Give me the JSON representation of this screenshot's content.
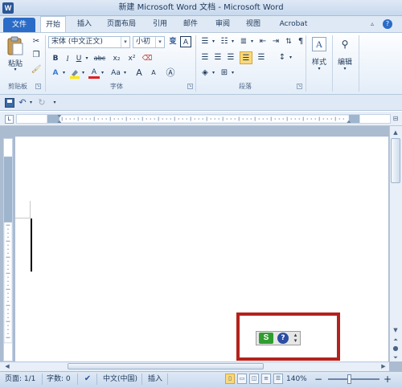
{
  "window": {
    "title": "新建 Microsoft Word 文档 - Microsoft Word",
    "app_icon": "W"
  },
  "tabs": {
    "file": "文件",
    "home": "开始",
    "insert": "插入",
    "page_layout": "页面布局",
    "references": "引用",
    "mailings": "邮件",
    "review": "审阅",
    "view": "视图",
    "acrobat": "Acrobat"
  },
  "ribbon": {
    "clipboard": {
      "label": "剪贴板",
      "paste_label": "粘贴"
    },
    "font": {
      "label": "字体",
      "font_name": "宋体 (中文正文)",
      "font_size": "小初",
      "bold": "B",
      "italic": "I",
      "underline": "U",
      "strike": "abc",
      "subscript": "x₂",
      "superscript": "x²",
      "wen": "A",
      "font_color": "A",
      "grow": "A",
      "shrink": "A",
      "change_case": "Aa",
      "phonetic": "变",
      "char_border": "A"
    },
    "paragraph": {
      "label": "段落"
    },
    "styles": {
      "label": "样式"
    },
    "editing": {
      "label": "编辑"
    }
  },
  "ime_toolbar": {
    "logo": "S",
    "help": "?"
  },
  "statusbar": {
    "page": "页面: 1/1",
    "words": "字数: 0",
    "language": "中文(中国)",
    "mode": "插入",
    "zoom": "140%"
  },
  "colors": {
    "file_tab": "#2a6cc8",
    "highlight_border": "#b3221c",
    "ime_logo": "#2f9e2f"
  }
}
